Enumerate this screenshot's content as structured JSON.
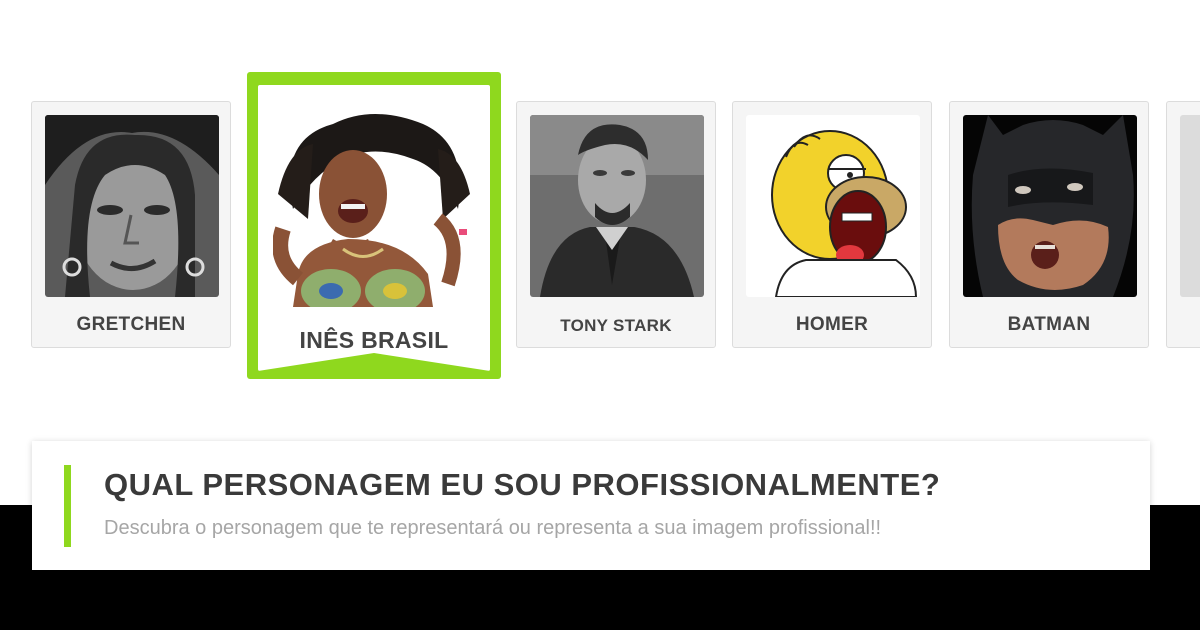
{
  "characters": [
    {
      "label": "GRETCHEN",
      "selected": false
    },
    {
      "label": "INÊS BRASIL",
      "selected": true
    },
    {
      "label": "TONY STARK",
      "selected": false
    },
    {
      "label": "HOMER",
      "selected": false
    },
    {
      "label": "BATMAN",
      "selected": false
    }
  ],
  "title": "QUAL PERSONAGEM EU SOU PROFISSIONALMENTE?",
  "subtitle": "Descubra o personagem que te representará ou representa a sua imagem profissional!!",
  "colors": {
    "accent": "#8fd81e",
    "card_bg": "#f5f5f5",
    "label_text": "#444444",
    "subtitle_text": "#a6a6a6",
    "bottom_band": "#000000"
  }
}
